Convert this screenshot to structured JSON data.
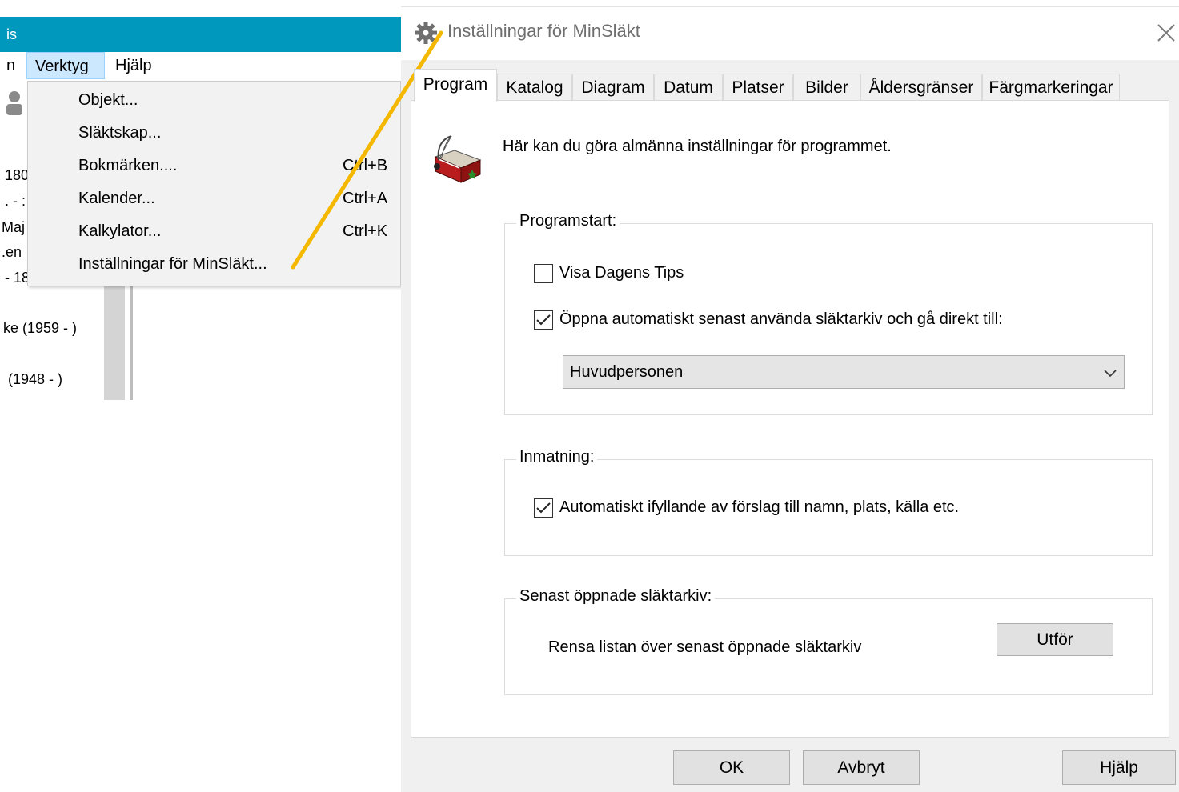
{
  "main_window": {
    "title_fragment": "is",
    "menubar": [
      "n",
      "Verktyg",
      "Hjälp"
    ],
    "background_fragments": [
      "180",
      ". - :",
      "Maj",
      ".en",
      "- 18",
      "ke (1959 - )",
      "(1948 - )"
    ]
  },
  "menu": {
    "items": [
      {
        "label": "Objekt...",
        "shortcut": ""
      },
      {
        "label": "Släktskap...",
        "shortcut": ""
      },
      {
        "label": "Bokmärken....",
        "shortcut": "Ctrl+B"
      },
      {
        "label": "Kalender...",
        "shortcut": "Ctrl+A"
      },
      {
        "label": "Kalkylator...",
        "shortcut": "Ctrl+K"
      },
      {
        "label": "Inställningar för MinSläkt...",
        "shortcut": ""
      }
    ]
  },
  "callout_color": "#f5b800",
  "dialog": {
    "title": "Inställningar för MinSläkt",
    "tabs": [
      "Program",
      "Katalog",
      "Diagram",
      "Datum",
      "Platser",
      "Bilder",
      "Åldersgränser",
      "Färgmarkeringar"
    ],
    "active_tab": "Program",
    "intro": "Här kan du göra almänna inställningar för programmet.",
    "groups": {
      "startup": {
        "legend": "Programstart:",
        "show_tips": {
          "label": "Visa Dagens Tips",
          "checked": false
        },
        "auto_open": {
          "label": "Öppna automatiskt senast använda släktarkiv och gå direkt till:",
          "checked": true
        },
        "select_value": "Huvudpersonen"
      },
      "input": {
        "legend": "Inmatning:",
        "autofill": {
          "label": "Automatiskt ifyllande av förslag till namn, plats, källa etc.",
          "checked": true
        }
      },
      "recent": {
        "legend": "Senast öppnade släktarkiv:",
        "clear_text": "Rensa listan över senast öppnade släktarkiv",
        "run_button": "Utför"
      }
    },
    "buttons": {
      "ok": "OK",
      "cancel": "Avbryt",
      "help": "Hjälp"
    }
  }
}
